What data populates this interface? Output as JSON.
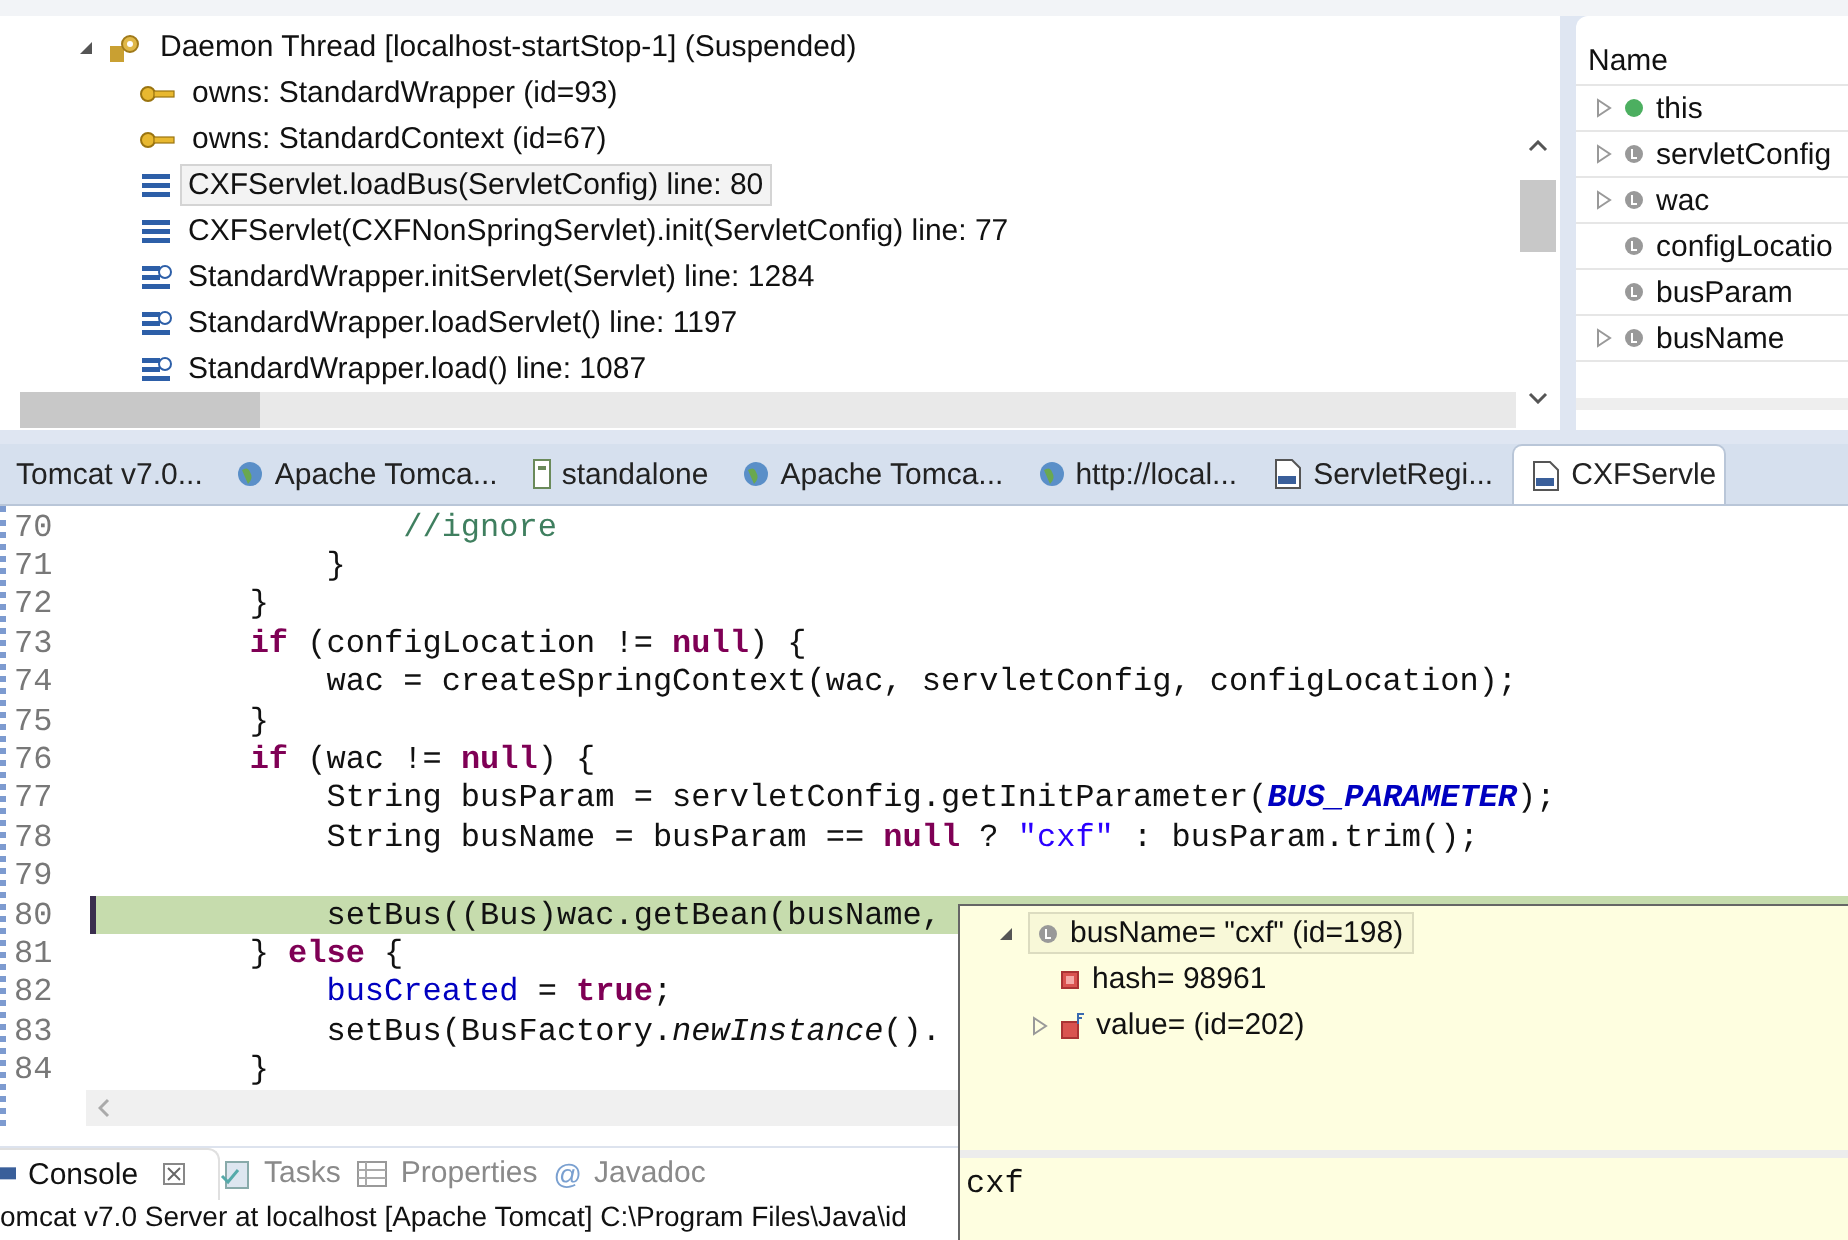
{
  "debug": {
    "tree": [
      {
        "label": "Daemon Thread [localhost-startStop-1] (Suspended)",
        "kind": "thread",
        "expanded": true,
        "selected": false,
        "children": [
          {
            "label": "owns: StandardWrapper  (id=93)",
            "kind": "monitor",
            "selected": false
          },
          {
            "label": "owns: StandardContext  (id=67)",
            "kind": "monitor",
            "selected": false
          },
          {
            "label": "CXFServlet.loadBus(ServletConfig) line: 80",
            "kind": "frame",
            "selected": true
          },
          {
            "label": "CXFServlet(CXFNonSpringServlet).init(ServletConfig) line: 77",
            "kind": "frame",
            "selected": false
          },
          {
            "label": "StandardWrapper.initServlet(Servlet) line: 1284",
            "kind": "frame-clock",
            "selected": false
          },
          {
            "label": "StandardWrapper.loadServlet() line: 1197",
            "kind": "frame-clock",
            "selected": false
          },
          {
            "label": "StandardWrapper.load() line: 1087",
            "kind": "frame-clock",
            "selected": false
          }
        ]
      }
    ]
  },
  "variables": {
    "column": "Name",
    "rows": [
      {
        "name": "this",
        "kind": "object",
        "expandable": true
      },
      {
        "name": "servletConfig",
        "kind": "local",
        "expandable": true
      },
      {
        "name": "wac",
        "kind": "local",
        "expandable": true
      },
      {
        "name": "configLocatio",
        "kind": "local",
        "expandable": false
      },
      {
        "name": "busParam",
        "kind": "local",
        "expandable": false
      },
      {
        "name": "busName",
        "kind": "local",
        "expandable": true
      }
    ]
  },
  "editor_tabs": [
    {
      "label": "Tomcat v7.0...",
      "kind": "none",
      "selected": false
    },
    {
      "label": "Apache Tomca...",
      "kind": "web",
      "selected": false
    },
    {
      "label": "standalone",
      "kind": "file",
      "selected": false
    },
    {
      "label": "Apache Tomca...",
      "kind": "web",
      "selected": false
    },
    {
      "label": "http://local...",
      "kind": "web",
      "selected": false
    },
    {
      "label": "ServletRegi...",
      "kind": "class",
      "selected": false
    },
    {
      "label": "CXFServle",
      "kind": "class",
      "selected": true
    }
  ],
  "code": [
    {
      "number": "70",
      "current": false,
      "tokens": [
        {
          "kind": "comment",
          "text": "                //ignore"
        }
      ]
    },
    {
      "number": "71",
      "current": false,
      "tokens": [
        {
          "kind": "plain",
          "text": "            }"
        }
      ]
    },
    {
      "number": "72",
      "current": false,
      "tokens": [
        {
          "kind": "plain",
          "text": "        }"
        }
      ]
    },
    {
      "number": "73",
      "current": false,
      "tokens": [
        {
          "kind": "keyword",
          "text": "        if"
        },
        {
          "kind": "plain",
          "text": " (configLocation != "
        },
        {
          "kind": "keyword",
          "text": "null"
        },
        {
          "kind": "plain",
          "text": ") {"
        }
      ]
    },
    {
      "number": "74",
      "current": false,
      "tokens": [
        {
          "kind": "plain",
          "text": "            wac = createSpringContext(wac, servletConfig, configLocation);"
        }
      ]
    },
    {
      "number": "75",
      "current": false,
      "tokens": [
        {
          "kind": "plain",
          "text": "        }"
        }
      ]
    },
    {
      "number": "76",
      "current": false,
      "tokens": [
        {
          "kind": "keyword",
          "text": "        if"
        },
        {
          "kind": "plain",
          "text": " (wac != "
        },
        {
          "kind": "keyword",
          "text": "null"
        },
        {
          "kind": "plain",
          "text": ") {"
        }
      ]
    },
    {
      "number": "77",
      "current": false,
      "tokens": [
        {
          "kind": "plain",
          "text": "            String busParam = servletConfig.getInitParameter("
        },
        {
          "kind": "constant",
          "text": "BUS_PARAMETER"
        },
        {
          "kind": "plain",
          "text": ");"
        }
      ]
    },
    {
      "number": "78",
      "current": false,
      "tokens": [
        {
          "kind": "plain",
          "text": "            String busName = busParam == "
        },
        {
          "kind": "keyword",
          "text": "null"
        },
        {
          "kind": "plain",
          "text": " ? "
        },
        {
          "kind": "string",
          "text": "\"cxf\""
        },
        {
          "kind": "plain",
          "text": " : busParam.trim();"
        }
      ]
    },
    {
      "number": "79",
      "current": false
    },
    {
      "number": "80",
      "current": true,
      "tokens": [
        {
          "kind": "plain",
          "text": "            setBus((Bus)wac.getBean(busName,"
        }
      ]
    },
    {
      "number": "81",
      "current": false,
      "tokens": [
        {
          "kind": "plain",
          "text": "        } "
        },
        {
          "kind": "keyword",
          "text": "else"
        },
        {
          "kind": "plain",
          "text": " {"
        }
      ]
    },
    {
      "number": "82",
      "current": false,
      "tokens": [
        {
          "kind": "field",
          "text": "            busCreated"
        },
        {
          "kind": "plain",
          "text": " = "
        },
        {
          "kind": "keyword",
          "text": "true"
        },
        {
          "kind": "plain",
          "text": ";"
        }
      ]
    },
    {
      "number": "83",
      "current": false,
      "tokens": [
        {
          "kind": "plain",
          "text": "            setBus(BusFactory."
        },
        {
          "kind": "static",
          "text": "newInstance"
        },
        {
          "kind": "plain",
          "text": "()."
        }
      ]
    },
    {
      "number": "84",
      "current": false,
      "tokens": [
        {
          "kind": "plain",
          "text": "        }"
        }
      ]
    }
  ],
  "hover": {
    "tree": [
      {
        "label": "busName= \"cxf\" (id=198)",
        "kind": "local",
        "expanded": true,
        "selected": true,
        "children": [
          {
            "label": "hash= 98961",
            "kind": "field",
            "expandable": false
          },
          {
            "label": "value= (id=202)",
            "kind": "final-field",
            "expandable": true
          }
        ]
      }
    ],
    "detail": "cxf"
  },
  "bottom_tabs": [
    {
      "label": "Console",
      "kind": "console",
      "selected": true
    },
    {
      "label": "Tasks",
      "kind": "tasks",
      "selected": false
    },
    {
      "label": "Properties",
      "kind": "properties",
      "selected": false
    },
    {
      "label": "Javadoc",
      "kind": "glyph",
      "glyph": "@",
      "selected": false
    }
  ],
  "console_line": "omcat v7.0 Server at localhost [Apache Tomcat] C:\\Program Files\\Java\\id"
}
